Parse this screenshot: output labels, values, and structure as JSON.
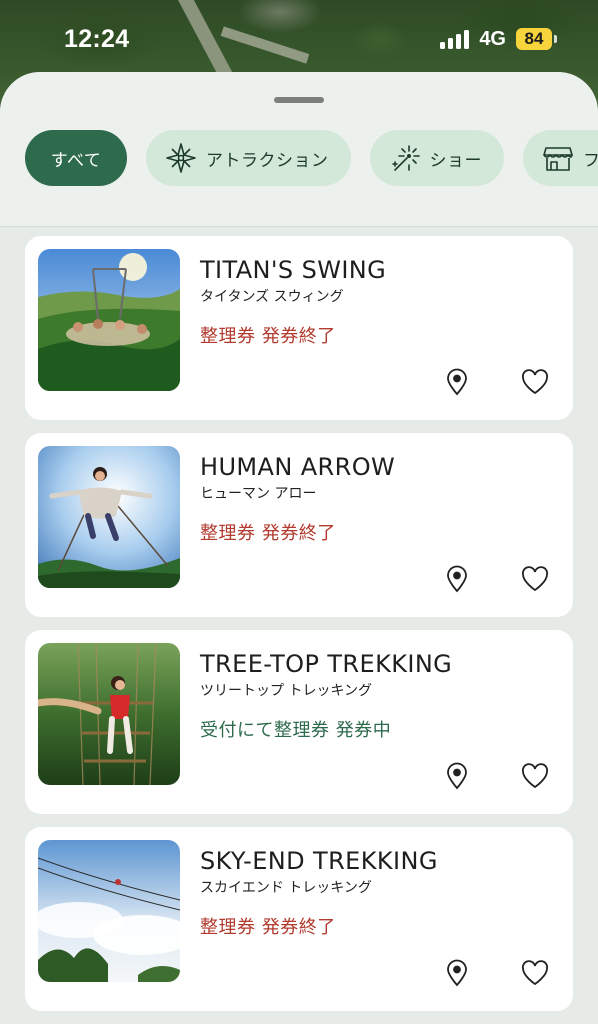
{
  "status_bar": {
    "time": "12:24",
    "network": "4G",
    "battery": "84"
  },
  "filters": [
    {
      "label": "すべて",
      "icon": null,
      "active": true
    },
    {
      "label": "アトラクション",
      "icon": "compass-icon",
      "active": false
    },
    {
      "label": "ショー",
      "icon": "fireworks-icon",
      "active": false
    },
    {
      "label": "フー",
      "icon": "shop-icon",
      "active": false
    }
  ],
  "attractions": [
    {
      "title": "TITAN'S SWING",
      "subtitle": "タイタンズ スウィング",
      "status": "整理券 発券終了",
      "status_color": "#b23a2e"
    },
    {
      "title": "HUMAN ARROW",
      "subtitle": "ヒューマン アロー",
      "status": "整理券 発券終了",
      "status_color": "#b23a2e"
    },
    {
      "title": "TREE-TOP TREKKING",
      "subtitle": "ツリートップ トレッキング",
      "status": "受付にて整理券 発券中",
      "status_color": "#2e6a4c"
    },
    {
      "title": "SKY-END TREKKING",
      "subtitle": "スカイエンド トレッキング",
      "status": "整理券 発券終了",
      "status_color": "#b23a2e"
    }
  ],
  "colors": {
    "accent": "#2e6a4c",
    "chip_bg": "#d3e8d9",
    "closed": "#b23a2e",
    "open": "#2e6a4c"
  }
}
